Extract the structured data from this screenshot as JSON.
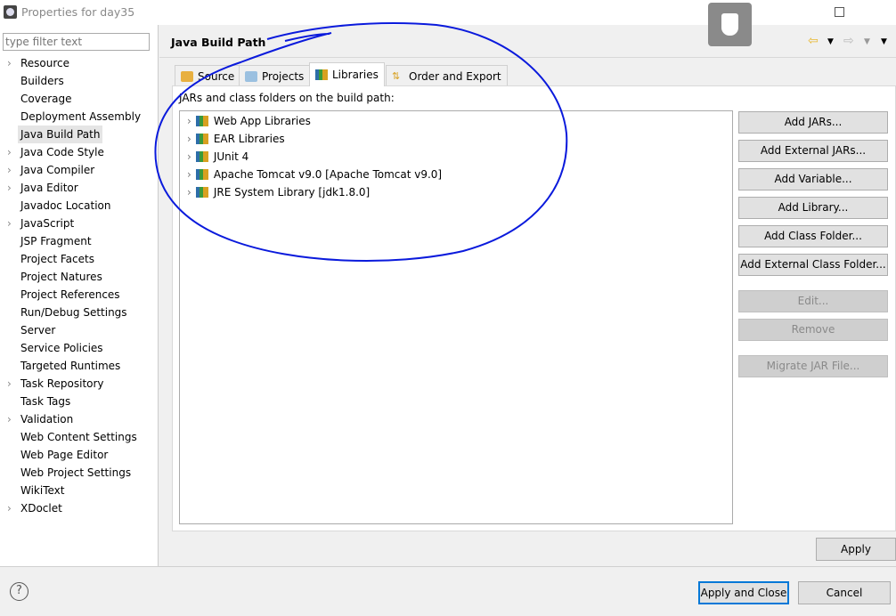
{
  "window": {
    "title": "Properties for day35"
  },
  "filter": {
    "placeholder": "type filter text"
  },
  "sidebar": {
    "items": [
      {
        "label": "Resource",
        "expandable": true
      },
      {
        "label": "Builders"
      },
      {
        "label": "Coverage"
      },
      {
        "label": "Deployment Assembly"
      },
      {
        "label": "Java Build Path",
        "selected": true
      },
      {
        "label": "Java Code Style",
        "expandable": true
      },
      {
        "label": "Java Compiler",
        "expandable": true
      },
      {
        "label": "Java Editor",
        "expandable": true
      },
      {
        "label": "Javadoc Location"
      },
      {
        "label": "JavaScript",
        "expandable": true
      },
      {
        "label": "JSP Fragment"
      },
      {
        "label": "Project Facets"
      },
      {
        "label": "Project Natures"
      },
      {
        "label": "Project References"
      },
      {
        "label": "Run/Debug Settings"
      },
      {
        "label": "Server"
      },
      {
        "label": "Service Policies"
      },
      {
        "label": "Targeted Runtimes"
      },
      {
        "label": "Task Repository",
        "expandable": true
      },
      {
        "label": "Task Tags"
      },
      {
        "label": "Validation",
        "expandable": true
      },
      {
        "label": "Web Content Settings"
      },
      {
        "label": "Web Page Editor"
      },
      {
        "label": "Web Project Settings"
      },
      {
        "label": "WikiText"
      },
      {
        "label": "XDoclet",
        "expandable": true
      }
    ]
  },
  "main": {
    "title": "Java Build Path",
    "tabs": [
      {
        "label": "Source"
      },
      {
        "label": "Projects"
      },
      {
        "label": "Libraries",
        "active": true
      },
      {
        "label": "Order and Export"
      }
    ],
    "list_label": "JARs and class folders on the build path:",
    "libraries": [
      "Web App Libraries",
      "EAR Libraries",
      "JUnit 4",
      "Apache Tomcat v9.0 [Apache Tomcat v9.0]",
      "JRE System Library [jdk1.8.0]"
    ],
    "buttons": [
      {
        "label": "Add JARs...",
        "enabled": true
      },
      {
        "label": "Add External JARs...",
        "enabled": true
      },
      {
        "label": "Add Variable...",
        "enabled": true
      },
      {
        "label": "Add Library...",
        "enabled": true
      },
      {
        "label": "Add Class Folder...",
        "enabled": true
      },
      {
        "label": "Add External Class Folder...",
        "enabled": true
      },
      {
        "label": "Edit...",
        "enabled": false
      },
      {
        "label": "Remove",
        "enabled": false
      },
      {
        "label": "Migrate JAR File...",
        "enabled": false
      }
    ],
    "apply": "Apply"
  },
  "footer": {
    "help": "?",
    "apply_close": "Apply and Close",
    "cancel": "Cancel"
  },
  "colors": {
    "annotation": "#0a1adc",
    "focus": "#0078d7",
    "nav_back": "#e8b830"
  }
}
